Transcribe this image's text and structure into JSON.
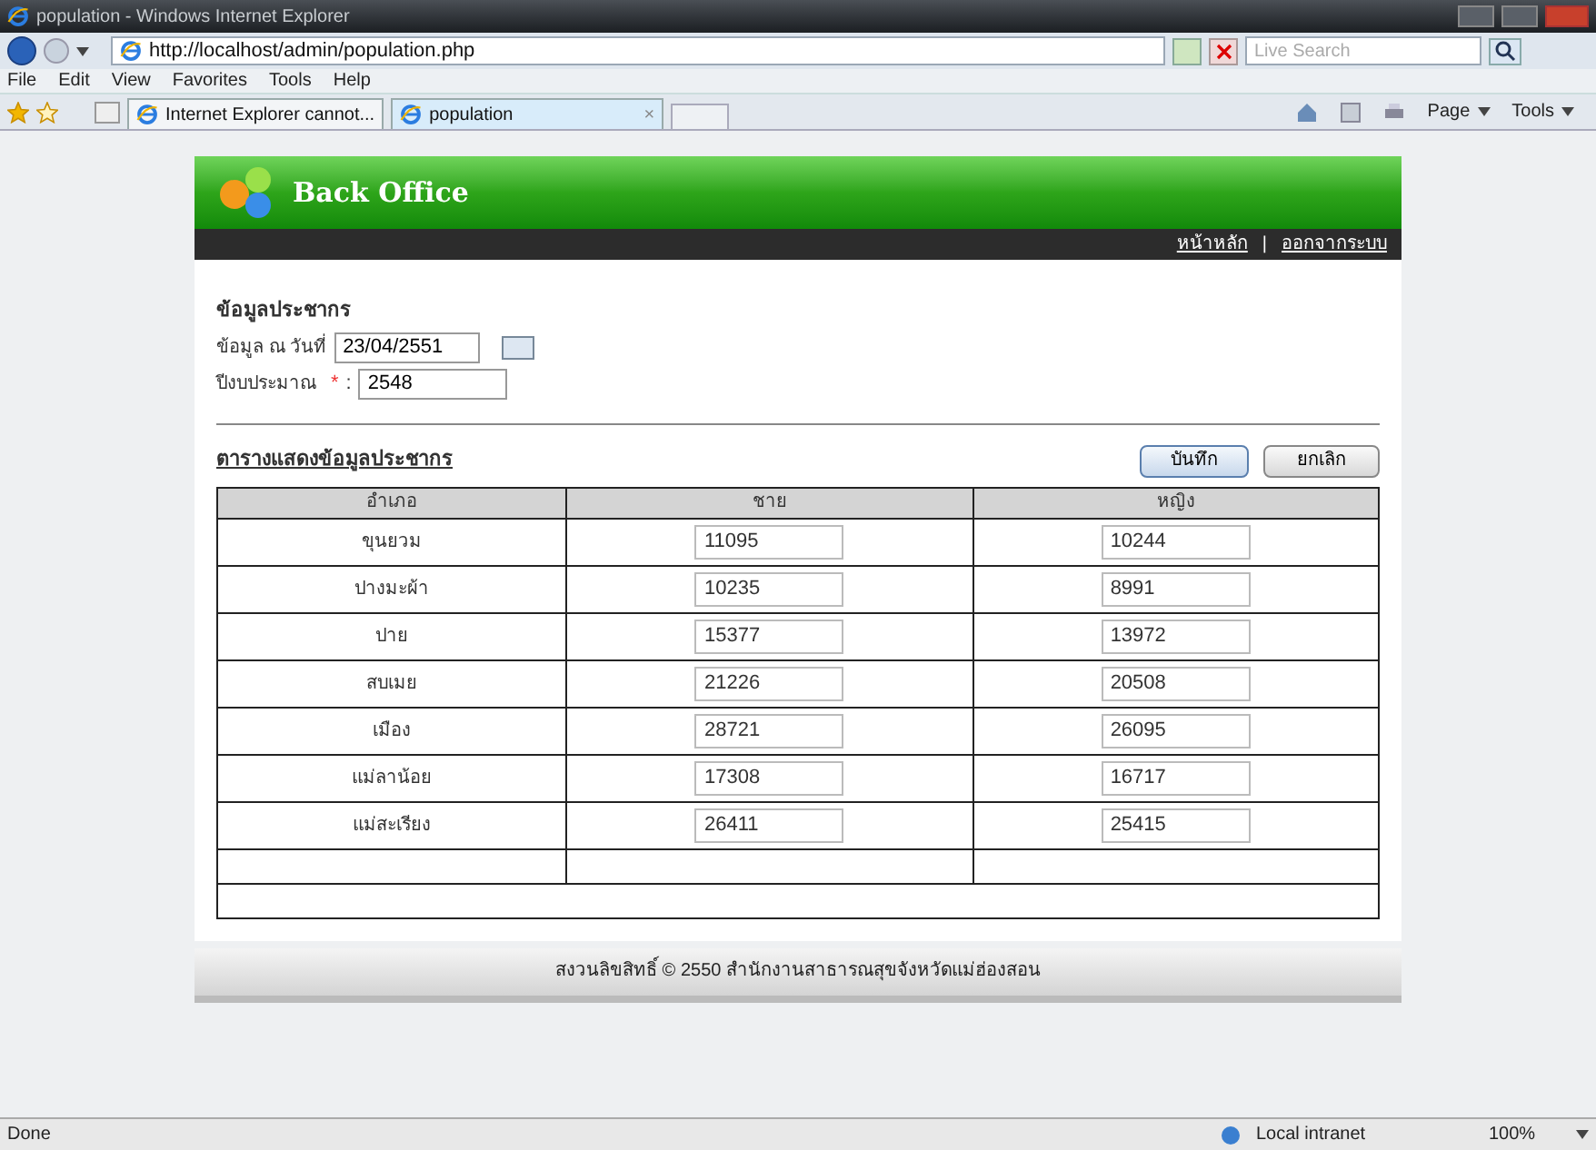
{
  "window": {
    "title": "population - Windows Internet Explorer"
  },
  "address_bar": {
    "url": "http://localhost/admin/population.php"
  },
  "search": {
    "placeholder": "Live Search"
  },
  "menu": [
    "File",
    "Edit",
    "View",
    "Favorites",
    "Tools",
    "Help"
  ],
  "tabs": [
    {
      "label": "Internet Explorer cannot...",
      "selected": false
    },
    {
      "label": "population",
      "selected": true
    }
  ],
  "tab_close": "×",
  "command_bar": [
    "Page",
    "Tools"
  ],
  "site": {
    "title": "Back Office",
    "nav": [
      "หน้าหลัก",
      "ออกจากระบบ"
    ],
    "nav_separator": "|"
  },
  "form": {
    "heading": "ข้อมูลประชากร",
    "date": {
      "label": "ข้อมูล ณ วันที่",
      "value": "23/04/2551"
    },
    "year": {
      "label": "ปีงบประมาณ",
      "required": "*",
      "colon": ":",
      "value": "2548"
    }
  },
  "table_title": "ตารางแสดงข้อมูลประชากร",
  "buttons": [
    "บันทึก",
    "ยกเลิก"
  ],
  "table": {
    "columns": [
      "อำเภอ",
      "ชาย",
      "หญิง"
    ],
    "rows": [
      [
        "ขุนยวม",
        "11095",
        "10244"
      ],
      [
        "ปางมะผ้า",
        "10235",
        "8991"
      ],
      [
        "ปาย",
        "15377",
        "13972"
      ],
      [
        "สบเมย",
        "21226",
        "20508"
      ],
      [
        "เมือง",
        "28721",
        "26095"
      ],
      [
        "แม่ลาน้อย",
        "17308",
        "16717"
      ],
      [
        "แม่สะเรียง",
        "26411",
        "25415"
      ]
    ]
  },
  "footer": "สงวนลิขสิทธิ์ © 2550 สำนักงานสาธารณสุขจังหวัดแม่ฮ่องสอน",
  "status_bar": {
    "text": "Done",
    "zone": "Local intranet",
    "zoom": "100%"
  }
}
